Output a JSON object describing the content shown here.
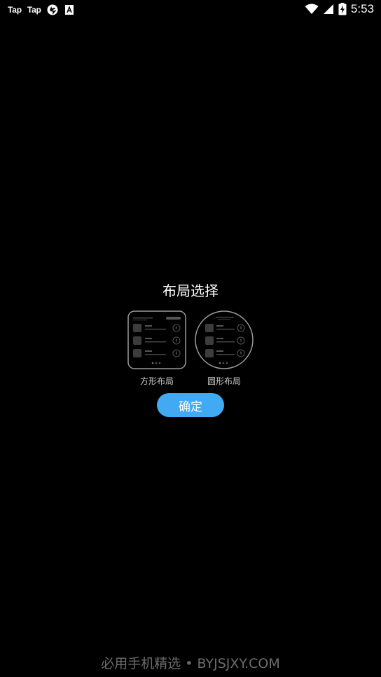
{
  "status_bar": {
    "app1": "Tap",
    "app2": "Tap",
    "icons": [
      "taptap-text",
      "taptap-text",
      "sync-arrows-icon",
      "font-a-icon"
    ],
    "right_icons": [
      "wifi-icon",
      "cellular-signal-icon",
      "battery-charging-icon"
    ],
    "time": "5:53"
  },
  "dialog": {
    "title": "布局选择",
    "options": [
      {
        "label": "方形布局",
        "icon": "square-layout-preview"
      },
      {
        "label": "圆形布局",
        "icon": "round-layout-preview"
      }
    ],
    "confirm_label": "确定"
  },
  "watermark": "必用手机精选 • BYJSJXY.COM",
  "colors": {
    "background": "#000000",
    "accent": "#42aaf3",
    "label": "#c8c8c8",
    "watermark": "#6c6c6c"
  }
}
